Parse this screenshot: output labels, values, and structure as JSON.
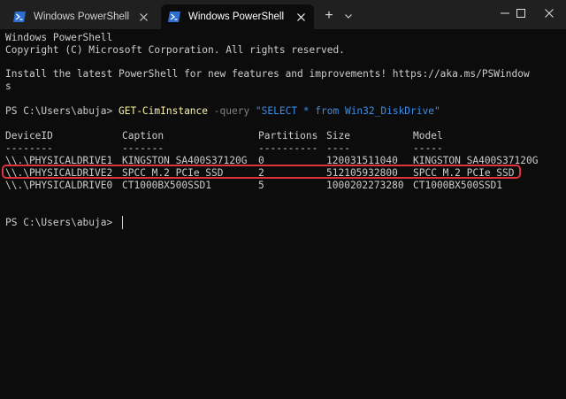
{
  "tabs": [
    {
      "label": "Windows PowerShell",
      "active": false
    },
    {
      "label": "Windows PowerShell",
      "active": true
    }
  ],
  "new_tab_label": "+",
  "window_controls": {
    "minimize": "minimize-icon",
    "maximize": "maximize-icon",
    "close": "close-icon"
  },
  "terminal": {
    "banner": [
      "Windows PowerShell",
      "Copyright (C) Microsoft Corporation. All rights reserved.",
      "Install the latest PowerShell for new features and improvements! https://aka.ms/PSWindow",
      "s"
    ],
    "prompt1": "PS C:\\Users\\abuja> ",
    "command": {
      "cmdlet": "GET-CimInstance",
      "param": " -query ",
      "string": "\"SELECT * from Win32_DiskDrive\""
    },
    "table": {
      "headers": [
        "DeviceID",
        "Caption",
        "Partitions",
        "Size",
        "Model"
      ],
      "underlines": [
        "--------",
        "-------",
        "----------",
        "----",
        "-----"
      ],
      "rows": [
        [
          "\\\\.\\PHYSICALDRIVE1",
          "KINGSTON SA400S37120G",
          "0",
          "120031511040",
          "KINGSTON SA400S37120G"
        ],
        [
          "\\\\.\\PHYSICALDRIVE2",
          "SPCC M.2 PCIe SSD",
          "2",
          "512105932800",
          "SPCC M.2 PCIe SSD"
        ],
        [
          "\\\\.\\PHYSICALDRIVE0",
          "CT1000BX500SSD1",
          "5",
          "1000202273280",
          "CT1000BX500SSD1"
        ]
      ]
    },
    "prompt2": "PS C:\\Users\\abuja> "
  },
  "colors": {
    "background": "#0c0c0c",
    "titlebar": "#202020",
    "text": "#cccccc",
    "cmdlet": "#f9f1a5",
    "string": "#3b8eea",
    "highlight": "#e0333b"
  }
}
